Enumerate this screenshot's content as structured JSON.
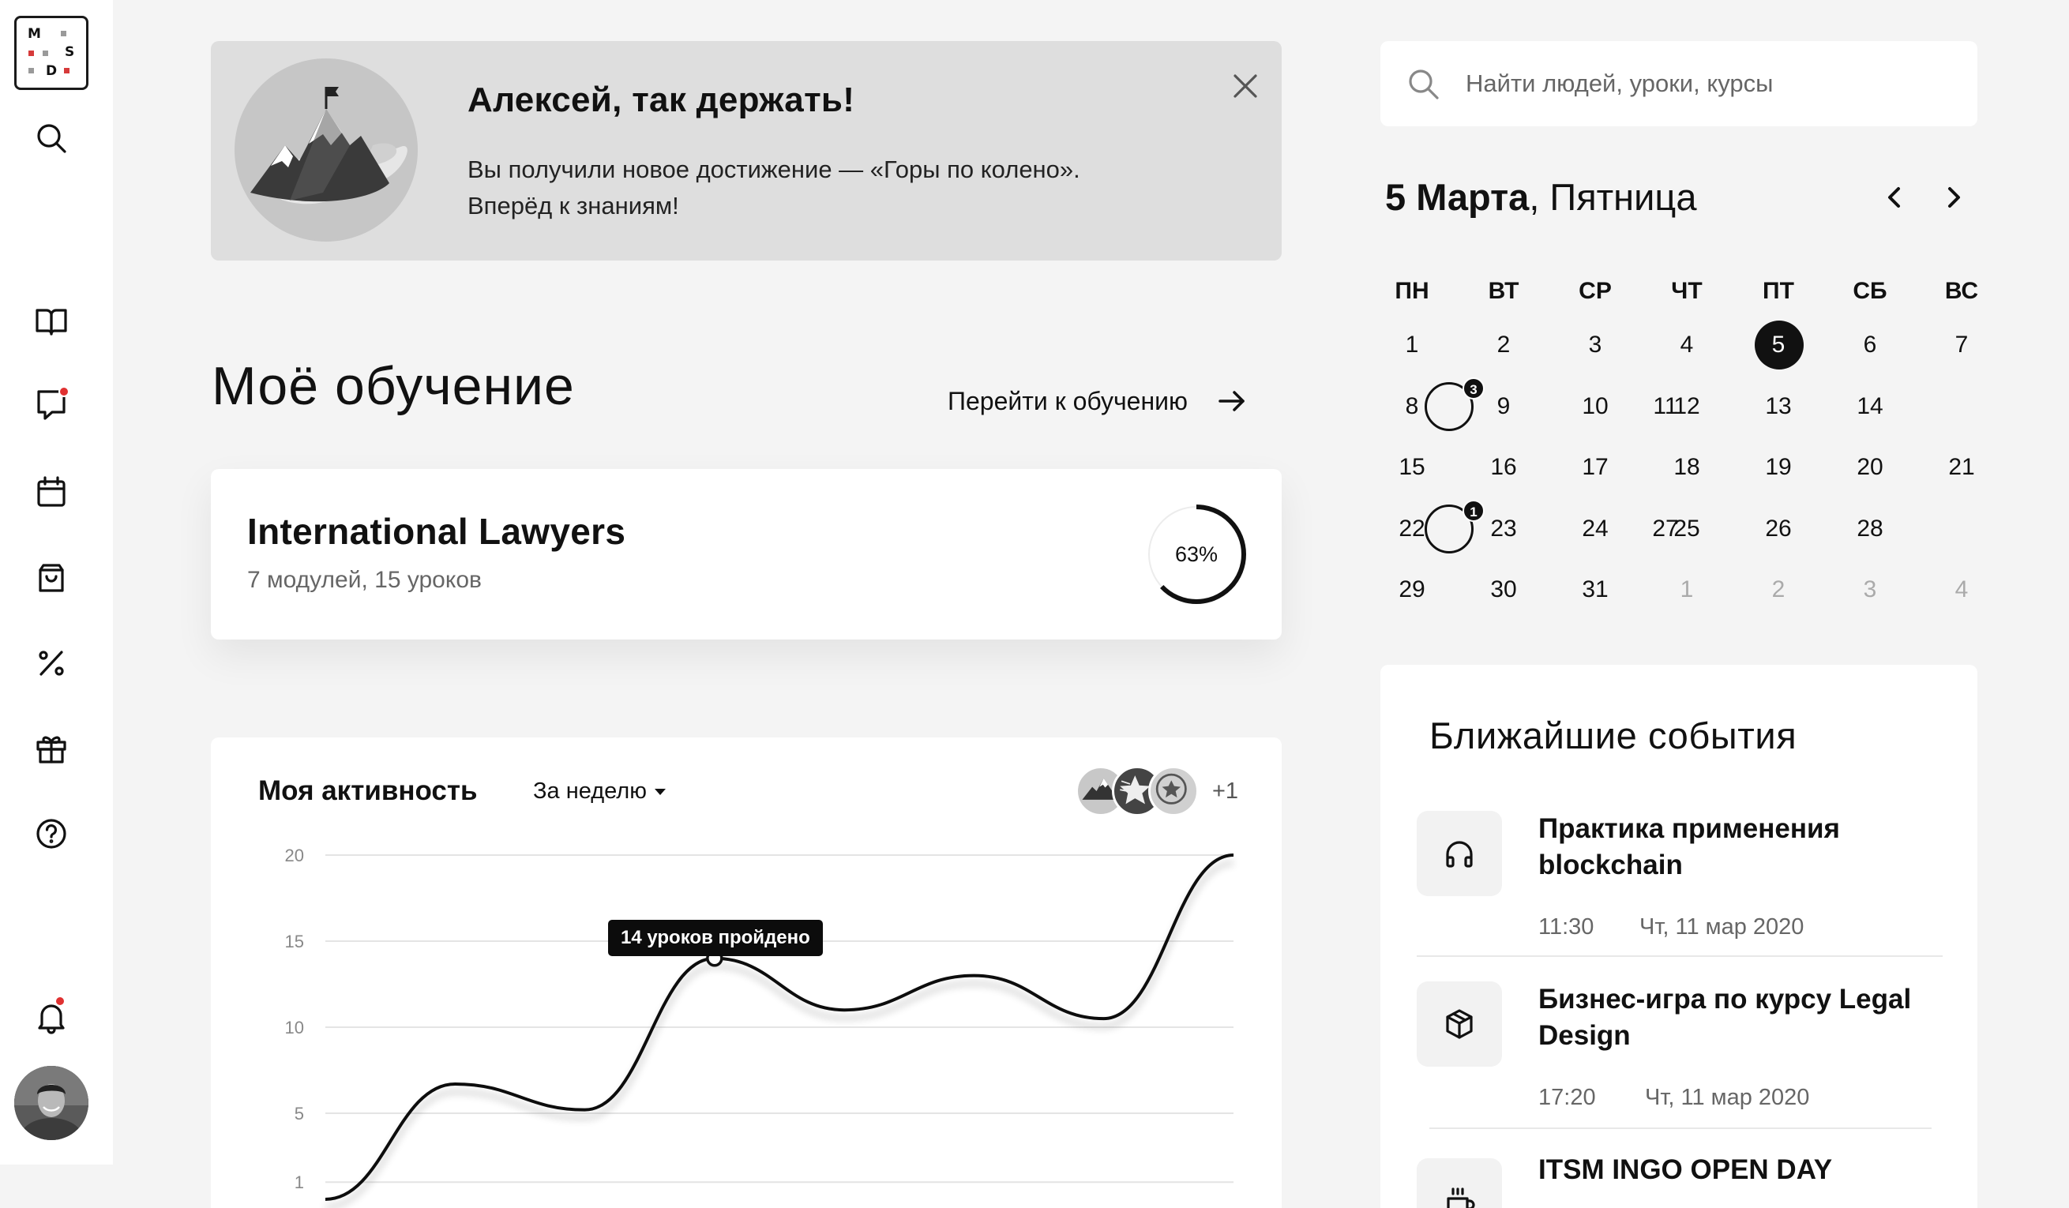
{
  "logo": {
    "letters": [
      "M",
      "S",
      "D"
    ]
  },
  "sidebar": {
    "items": [
      {
        "name": "search-icon"
      },
      {
        "name": "book-icon"
      },
      {
        "name": "chat-icon",
        "badge": true
      },
      {
        "name": "calendar-icon"
      },
      {
        "name": "shopping-bag-icon"
      },
      {
        "name": "percent-icon"
      },
      {
        "name": "gift-icon"
      },
      {
        "name": "help-icon"
      },
      {
        "name": "bell-icon",
        "badge": true
      }
    ]
  },
  "banner": {
    "title": "Алексей, так держать!",
    "text_line1": "Вы получили новое достижение — «Горы по колено».",
    "text_line2": "Вперёд к знаниям!"
  },
  "learning": {
    "title": "Моё обучение",
    "goto_label": "Перейти к обучению"
  },
  "course": {
    "title": "International Lawyers",
    "subtitle": "7 модулей, 15 уроков",
    "progress_label": "63%",
    "progress": 0.63
  },
  "activity": {
    "title": "Моя активность",
    "filter": "За неделю",
    "badges_more": "+1",
    "tooltip": "14 уроков пройдено"
  },
  "chart_data": {
    "type": "line",
    "y_ticks": [
      "20",
      "15",
      "10",
      "5",
      "1"
    ],
    "ylim": [
      0,
      20
    ],
    "points": [
      [
        0,
        0
      ],
      [
        1,
        6.7
      ],
      [
        2,
        5.2
      ],
      [
        3,
        14
      ],
      [
        4,
        11
      ],
      [
        5,
        13
      ],
      [
        6,
        10.5
      ],
      [
        7,
        20
      ]
    ],
    "highlight_index": 3
  },
  "search": {
    "placeholder": "Найти людей, уроки, курсы"
  },
  "calendar": {
    "date_bold": "5 Марта",
    "date_rest": ", Пятница",
    "weekdays": [
      "ПН",
      "ВТ",
      "СР",
      "ЧТ",
      "ПТ",
      "СБ",
      "ВС"
    ],
    "weeks": [
      [
        {
          "d": "1"
        },
        {
          "d": "2"
        },
        {
          "d": "3"
        },
        {
          "d": "4"
        },
        {
          "d": "5",
          "today": true
        },
        {
          "d": "6"
        },
        {
          "d": "7"
        }
      ],
      [
        {
          "d": "8"
        },
        {
          "d": "9"
        },
        {
          "d": "10"
        },
        {
          "d": "11",
          "event": true,
          "count": "3"
        },
        {
          "d": "12"
        },
        {
          "d": "13"
        },
        {
          "d": "14"
        }
      ],
      [
        {
          "d": "15"
        },
        {
          "d": "16"
        },
        {
          "d": "17"
        },
        {
          "d": "18"
        },
        {
          "d": "19"
        },
        {
          "d": "20"
        },
        {
          "d": "21"
        }
      ],
      [
        {
          "d": "22"
        },
        {
          "d": "23"
        },
        {
          "d": "24"
        },
        {
          "d": "25"
        },
        {
          "d": "26"
        },
        {
          "d": "27",
          "event": true,
          "count": "1"
        },
        {
          "d": "28"
        }
      ],
      [
        {
          "d": "29"
        },
        {
          "d": "30"
        },
        {
          "d": "31"
        },
        {
          "d": "1",
          "muted": true
        },
        {
          "d": "2",
          "muted": true
        },
        {
          "d": "3",
          "muted": true
        },
        {
          "d": "4",
          "muted": true
        }
      ]
    ]
  },
  "events": {
    "title": "Ближайшие события",
    "items": [
      {
        "icon": "headphones-icon",
        "title": "Практика применения blockchain",
        "time": "11:30",
        "date": "Чт, 11 мар 2020"
      },
      {
        "icon": "cube-icon",
        "title": "Бизнес-игра по курсу Legal Design",
        "time": "17:20",
        "date": "Чт, 11 мар 2020"
      },
      {
        "icon": "coffee-icon",
        "title": "ITSM INGO OPEN DAY",
        "time": "",
        "date": ""
      }
    ]
  }
}
